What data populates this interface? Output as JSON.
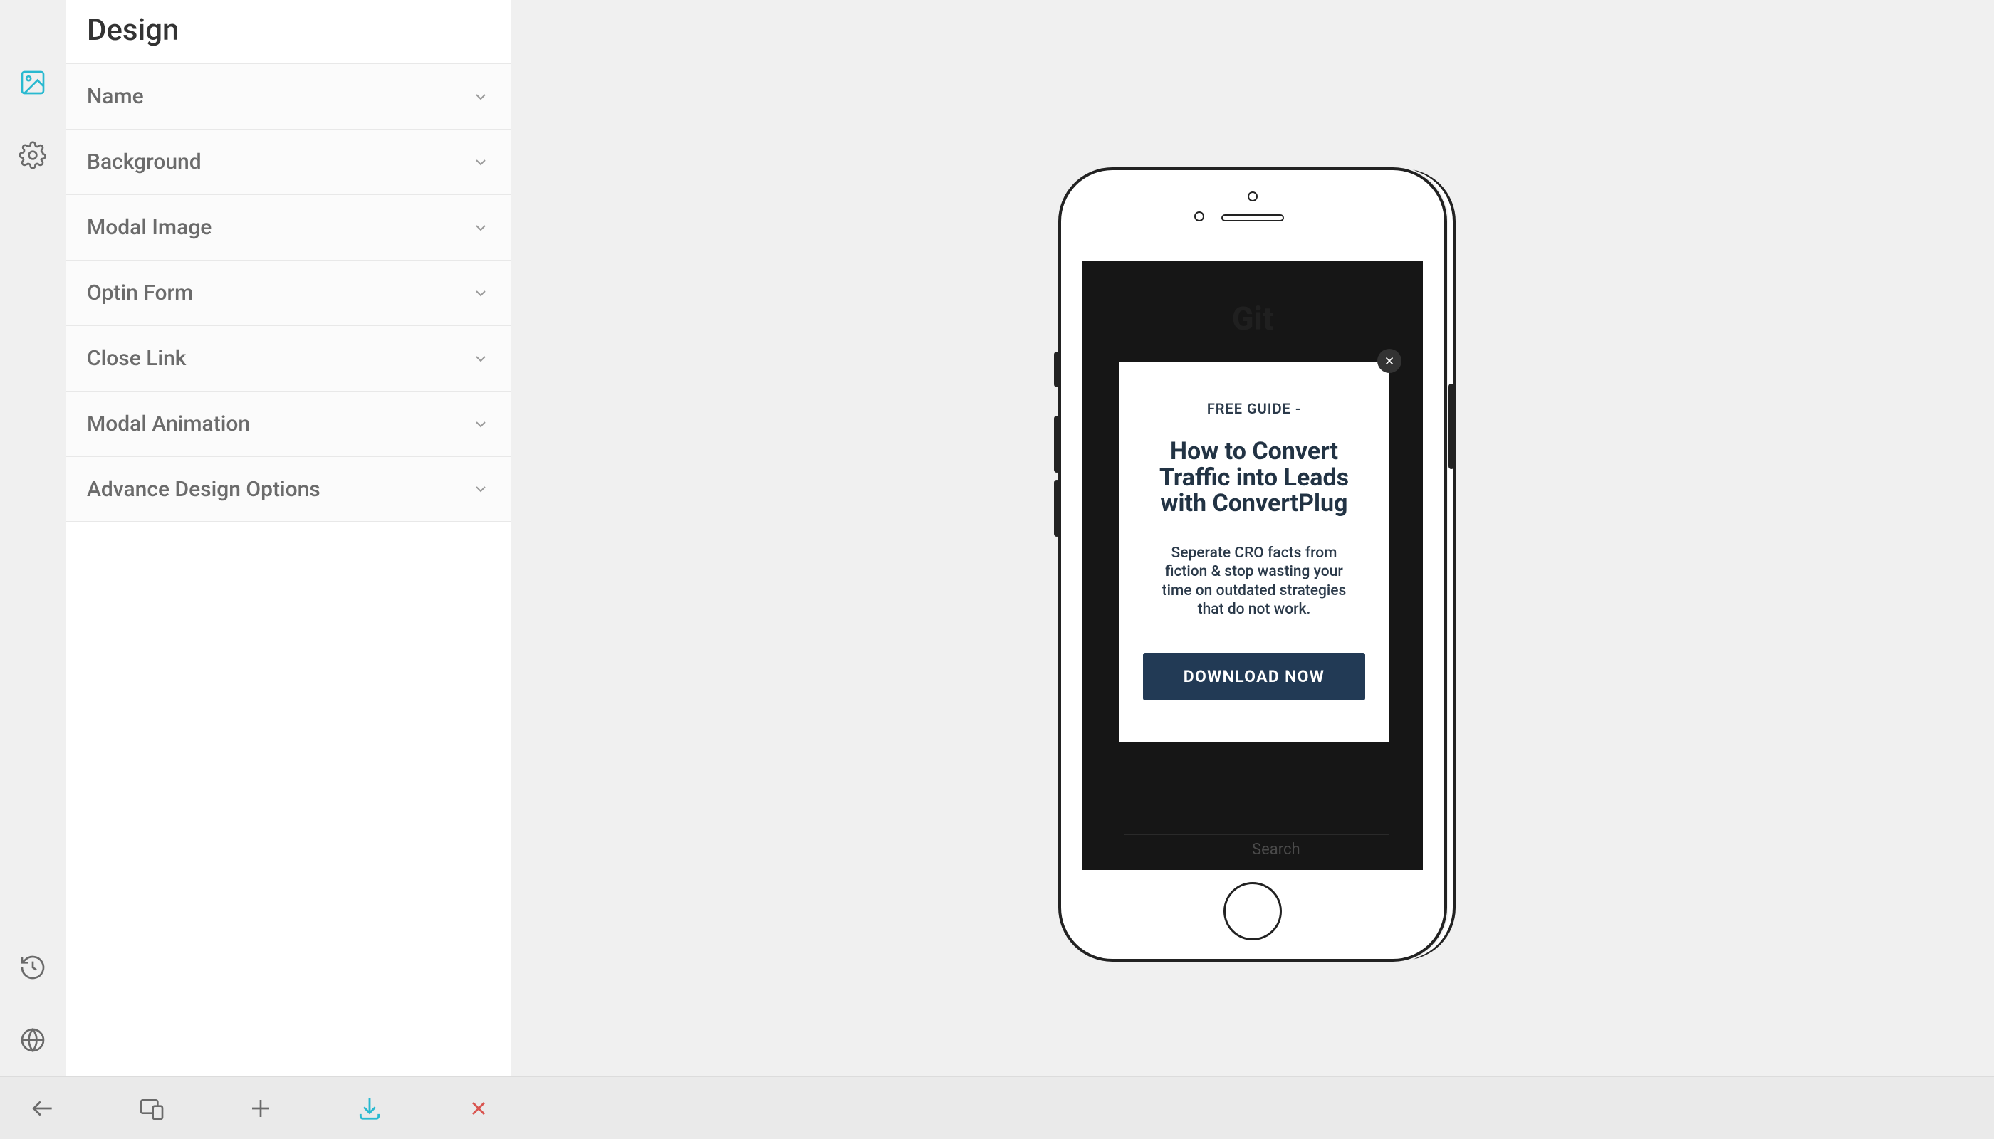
{
  "sidebar": {
    "title": "Design",
    "items": [
      {
        "label": "Name"
      },
      {
        "label": "Background"
      },
      {
        "label": "Modal Image"
      },
      {
        "label": "Optin Form"
      },
      {
        "label": "Close Link"
      },
      {
        "label": "Modal Animation"
      },
      {
        "label": "Advance Design Options"
      }
    ]
  },
  "preview": {
    "backgroundTitle": "Git",
    "searchPlaceholder": "Search",
    "modal": {
      "eyebrow": "FREE GUIDE -",
      "heading": "How to Convert Traffic into Leads with ConvertPlug",
      "subtext": "Seperate CRO facts from fiction & stop wasting your time on outdated strategies that do not work.",
      "cta": "DOWNLOAD NOW"
    }
  },
  "colors": {
    "accent": "#29b9d0",
    "danger": "#d9544f",
    "ctaBg": "#223a55"
  }
}
